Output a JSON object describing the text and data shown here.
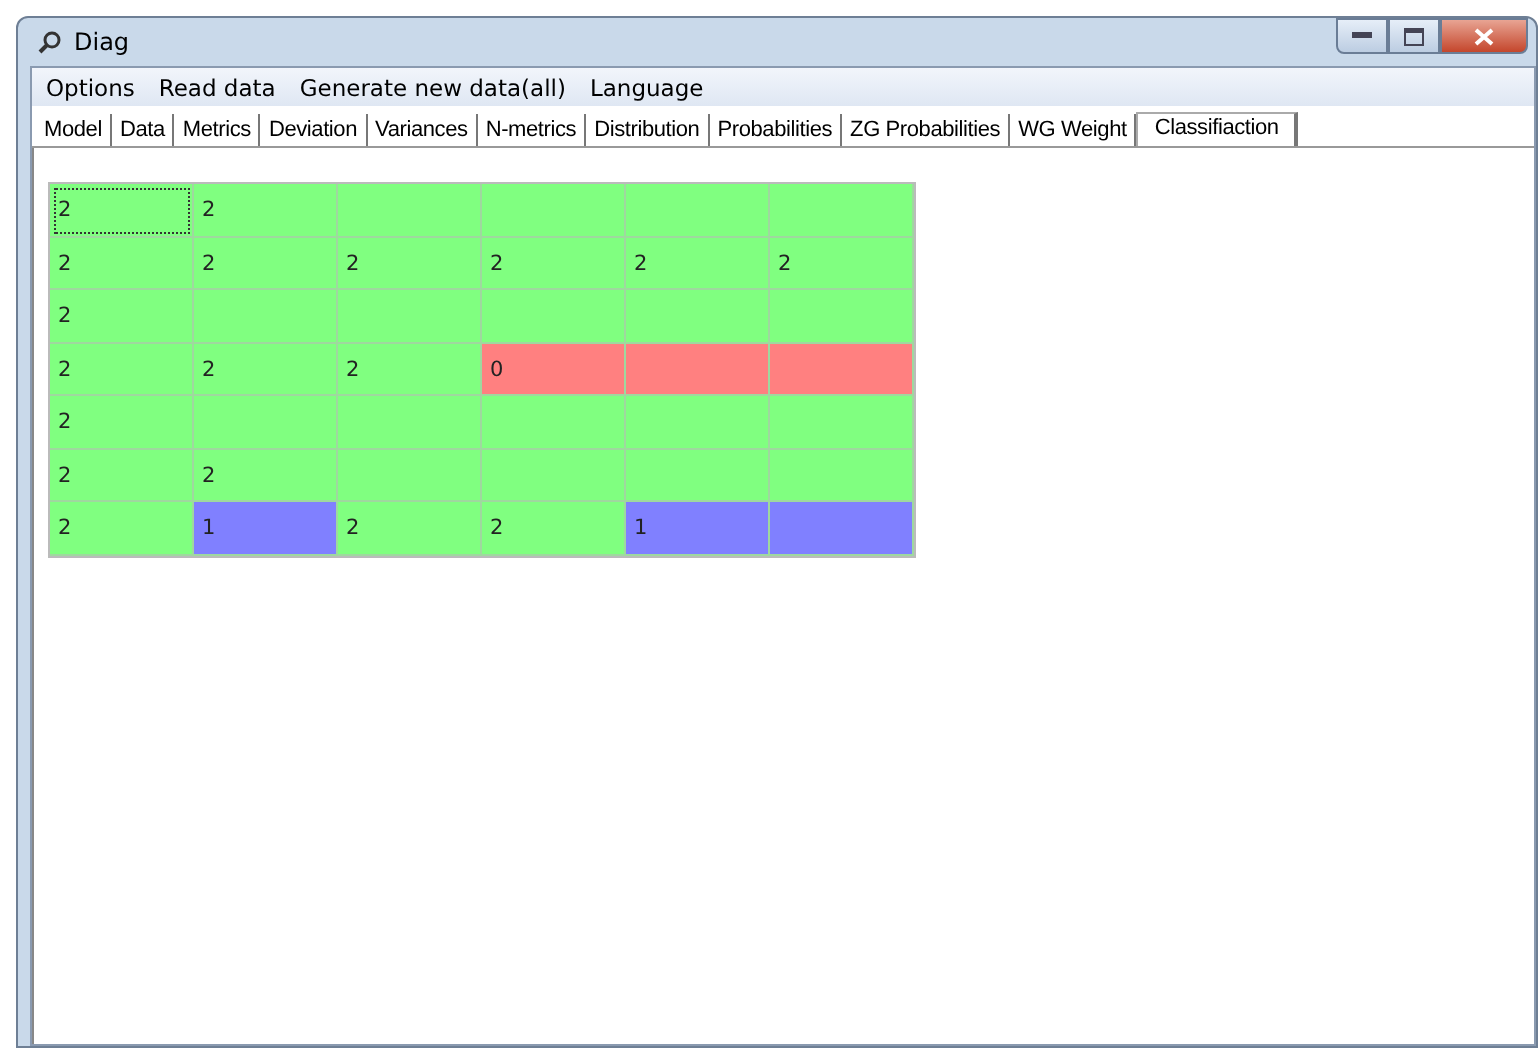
{
  "window": {
    "title": "Diag"
  },
  "menu": [
    {
      "label": "Options"
    },
    {
      "label": "Read data"
    },
    {
      "label": "Generate new data(all)"
    },
    {
      "label": "Language"
    }
  ],
  "tabs": [
    {
      "label": "Model",
      "selected": false
    },
    {
      "label": "Data",
      "selected": false
    },
    {
      "label": "Metrics",
      "selected": false
    },
    {
      "label": "Deviation",
      "selected": false
    },
    {
      "label": "Variances",
      "selected": false
    },
    {
      "label": "N-metrics",
      "selected": false
    },
    {
      "label": "Distribution",
      "selected": false
    },
    {
      "label": "Probabilities",
      "selected": false
    },
    {
      "label": "ZG Probabilities",
      "selected": false
    },
    {
      "label": "WG Weight",
      "selected": false
    },
    {
      "label": "Classifiaction",
      "selected": true
    }
  ],
  "grid": {
    "rows": [
      [
        {
          "value": "2",
          "color": "#80ff80",
          "selected": true
        },
        {
          "value": "2",
          "color": "#80ff80",
          "selected": false
        },
        {
          "color": "#80ff80",
          "selected": false
        },
        {
          "color": "#80ff80",
          "selected": false
        },
        {
          "color": "#80ff80",
          "selected": false
        },
        {
          "color": "#80ff80",
          "selected": false
        }
      ],
      [
        {
          "value": "2",
          "color": "#80ff80",
          "selected": false
        },
        {
          "value": "2",
          "color": "#80ff80",
          "selected": false
        },
        {
          "value": "2",
          "color": "#80ff80",
          "selected": false
        },
        {
          "value": "2",
          "color": "#80ff80",
          "selected": false
        },
        {
          "value": "2",
          "color": "#80ff80",
          "selected": false
        },
        {
          "value": "2",
          "color": "#80ff80",
          "selected": false
        }
      ],
      [
        {
          "value": "2",
          "color": "#80ff80",
          "selected": false
        },
        {
          "color": "#80ff80",
          "selected": false
        },
        {
          "color": "#80ff80",
          "selected": false
        },
        {
          "color": "#80ff80",
          "selected": false
        },
        {
          "color": "#80ff80",
          "selected": false
        },
        {
          "color": "#80ff80",
          "selected": false
        }
      ],
      [
        {
          "value": "2",
          "color": "#80ff80",
          "selected": false
        },
        {
          "value": "2",
          "color": "#80ff80",
          "selected": false
        },
        {
          "value": "2",
          "color": "#80ff80",
          "selected": false
        },
        {
          "value": "0",
          "color": "#ff8080",
          "selected": false
        },
        {
          "color": "#ff8080",
          "selected": false
        },
        {
          "color": "#ff8080",
          "selected": false
        }
      ],
      [
        {
          "value": "2",
          "color": "#80ff80",
          "selected": false
        },
        {
          "color": "#80ff80",
          "selected": false
        },
        {
          "color": "#80ff80",
          "selected": false
        },
        {
          "color": "#80ff80",
          "selected": false
        },
        {
          "color": "#80ff80",
          "selected": false
        },
        {
          "color": "#80ff80",
          "selected": false
        }
      ],
      [
        {
          "value": "2",
          "color": "#80ff80",
          "selected": false
        },
        {
          "value": "2",
          "color": "#80ff80",
          "selected": false
        },
        {
          "color": "#80ff80",
          "selected": false
        },
        {
          "color": "#80ff80",
          "selected": false
        },
        {
          "color": "#80ff80",
          "selected": false
        },
        {
          "color": "#80ff80",
          "selected": false
        }
      ],
      [
        {
          "value": "2",
          "color": "#80ff80",
          "selected": false
        },
        {
          "value": "1",
          "color": "#8080ff",
          "selected": false
        },
        {
          "value": "2",
          "color": "#80ff80",
          "selected": false
        },
        {
          "value": "2",
          "color": "#80ff80",
          "selected": false
        },
        {
          "value": "1",
          "color": "#8080ff",
          "selected": false
        },
        {
          "color": "#8080ff",
          "selected": false
        }
      ]
    ]
  }
}
